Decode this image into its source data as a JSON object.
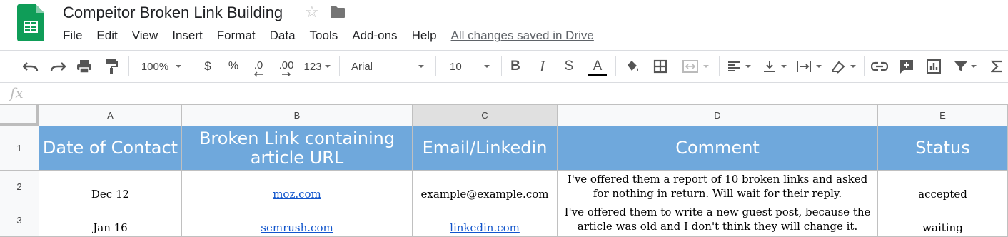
{
  "document": {
    "title": "Compeitor Broken Link Building",
    "save_status": "All changes saved in Drive"
  },
  "menu": [
    "File",
    "Edit",
    "View",
    "Insert",
    "Format",
    "Data",
    "Tools",
    "Add-ons",
    "Help"
  ],
  "toolbar": {
    "zoom": "100%",
    "currency": "$",
    "percent": "%",
    "decrease_decimals": ".0",
    "increase_decimals": ".00",
    "more_formats": "123",
    "font": "Arial",
    "font_size": "10",
    "bold": "B",
    "italic": "I",
    "strikethrough": "S",
    "text_color_letter": "A",
    "icons": [
      "undo-icon",
      "redo-icon",
      "print-icon",
      "paint-format-icon",
      "fill-color-icon",
      "borders-icon",
      "merge-cells-icon",
      "horizontal-align-icon",
      "vertical-align-icon",
      "text-wrap-icon",
      "text-rotation-icon",
      "insert-link-icon",
      "insert-comment-icon",
      "insert-chart-icon",
      "filter-icon",
      "functions-icon"
    ]
  },
  "formula_bar": {
    "label": "fx",
    "value": ""
  },
  "columns": [
    "A",
    "B",
    "C",
    "D",
    "E"
  ],
  "selected_column": "C",
  "rows": [
    "1",
    "2",
    "3"
  ],
  "header_row": {
    "a": "Date of Contact",
    "b": "Broken Link containing article URL",
    "c": "Email/Linkedin",
    "d": "Comment",
    "e": "Status"
  },
  "data_rows": [
    {
      "date": "Dec 12",
      "url": "moz.com",
      "contact": "example@example.com",
      "comment": "I've offered them a report of 10 broken links and asked for nothing in return. Will wait for their reply.",
      "status": "accepted"
    },
    {
      "date": "Jan 16",
      "url": "semrush.com",
      "contact": "linkedin.com",
      "comment": "I've offered them to write a new guest post, because the article was old and I don't think they will change it.",
      "status": "waiting"
    }
  ],
  "colors": {
    "header_fill": "#6fa8dc",
    "link": "#1155cc",
    "sheets_green": "#0f9d58"
  }
}
